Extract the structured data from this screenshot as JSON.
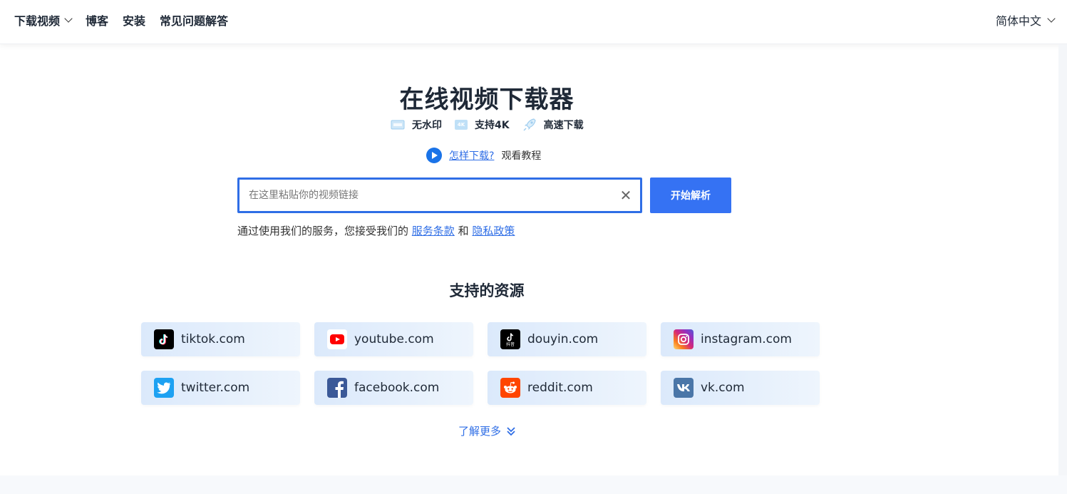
{
  "header": {
    "nav": [
      {
        "label": "下载视频",
        "has_dropdown": true
      },
      {
        "label": "博客"
      },
      {
        "label": "安装"
      },
      {
        "label": "常见问题解答"
      }
    ],
    "language": "简体中文"
  },
  "hero": {
    "title": "在线视频下载器",
    "features": [
      {
        "label": "无水印",
        "icon": "no-watermark-icon"
      },
      {
        "label": "支持4K",
        "icon": "4k-icon",
        "badge": "4K"
      },
      {
        "label": "高速下载",
        "icon": "rocket-icon"
      }
    ],
    "howto": {
      "link": "怎样下载?",
      "text": "观看教程"
    },
    "search": {
      "placeholder": "在这里粘贴你的视频链接",
      "value": "",
      "button": "开始解析"
    },
    "terms": {
      "prefix": "通过使用我们的服务，您接受我们的",
      "terms_link": "服务条款",
      "and": "和",
      "privacy_link": "隐私政策"
    }
  },
  "sources": {
    "title": "支持的资源",
    "items": [
      {
        "label": "tiktok.com",
        "icon": "tiktok-icon",
        "color": "#000000"
      },
      {
        "label": "youtube.com",
        "icon": "youtube-icon",
        "color": "#ff0000"
      },
      {
        "label": "douyin.com",
        "icon": "douyin-icon",
        "color": "#000000",
        "logo_text": "抖音"
      },
      {
        "label": "instagram.com",
        "icon": "instagram-icon",
        "color": "#d62976"
      },
      {
        "label": "twitter.com",
        "icon": "twitter-icon",
        "color": "#1da1f2"
      },
      {
        "label": "facebook.com",
        "icon": "facebook-icon",
        "color": "#3b5998"
      },
      {
        "label": "reddit.com",
        "icon": "reddit-icon",
        "color": "#ff4500"
      },
      {
        "label": "vk.com",
        "icon": "vk-icon",
        "color": "#4a76a8"
      }
    ],
    "more": "了解更多"
  },
  "colors": {
    "accent": "#3572f3",
    "link": "#2f6ee6"
  }
}
